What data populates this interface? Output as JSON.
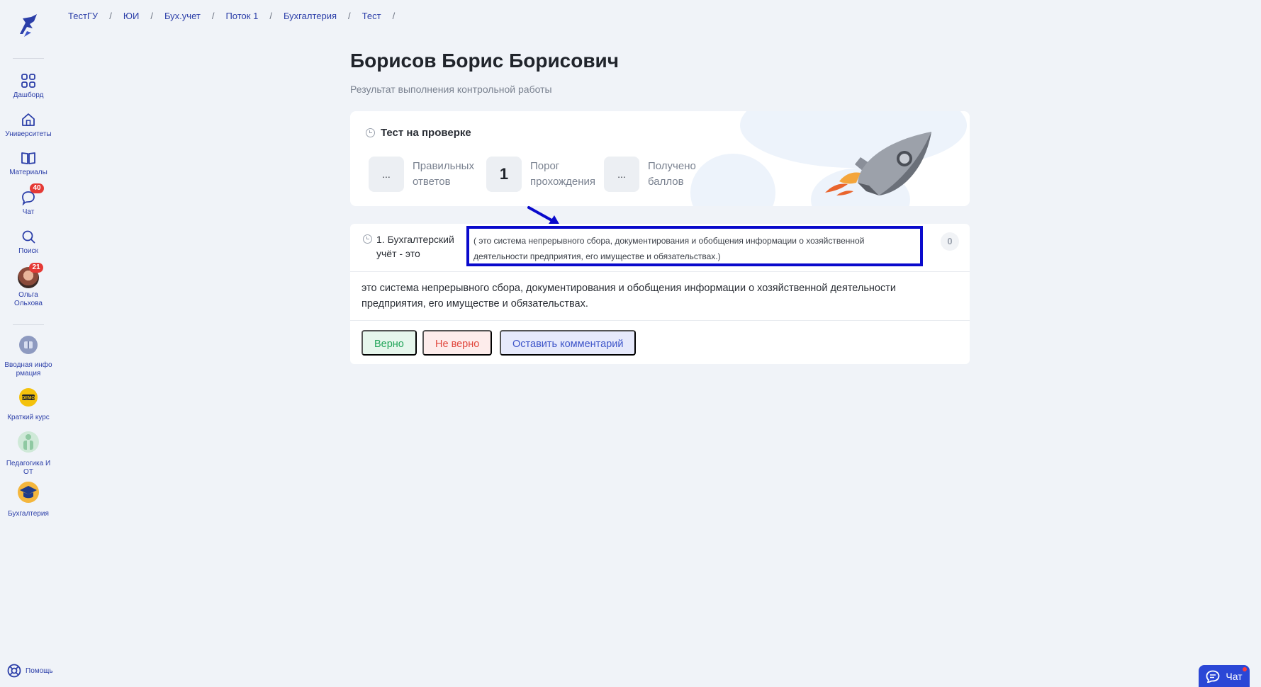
{
  "breadcrumb": [
    "ТестГУ",
    "ЮИ",
    "Бух.учет",
    "Поток 1",
    "Бухгалтерия",
    "Тест"
  ],
  "breadcrumb_sep": "/",
  "sidebar": {
    "items": [
      {
        "label": "Дашборд",
        "icon": "grid-icon"
      },
      {
        "label": "Университеты",
        "icon": "home-icon"
      },
      {
        "label": "Материалы",
        "icon": "book-icon"
      },
      {
        "label": "Чат",
        "icon": "chat-icon",
        "badge": "40"
      },
      {
        "label": "Поиск",
        "icon": "search-icon"
      },
      {
        "label": "Ольга Ольхова",
        "icon": "avatar",
        "badge": "21"
      }
    ],
    "courses": [
      {
        "label": "Вводная инфо рмация",
        "icon": "course-intro-icon"
      },
      {
        "label": "Краткий курс",
        "icon": "demo-icon"
      },
      {
        "label": "Педагогика И ОТ",
        "icon": "pedagogy-icon"
      },
      {
        "label": "Бухгалтерия",
        "icon": "graduation-cap-icon"
      }
    ],
    "help": "Помощь"
  },
  "header": {
    "title": "Борисов Борис Борисович",
    "subtitle": "Результат выполнения контрольной работы"
  },
  "summary": {
    "title": "Тест на проверке",
    "stats": [
      {
        "value": "...",
        "label": "Правильных ответов"
      },
      {
        "value": "1",
        "label": "Порог прохождения"
      },
      {
        "value": "...",
        "label": "Получено баллов"
      }
    ]
  },
  "question": {
    "number_text": "1. Бухгалтерский учёт - это",
    "highlight_text": "( это система непрерывного сбора, документирования и обобщения информации о хозяйственной деятельности предприятия, его имуществе и обязательствах.)",
    "score": "0",
    "answer": "это система непрерывного сбора, документирования и обобщения информации о хозяйственной деятельности предприятия, его имуществе и обязательствах.",
    "buttons": {
      "correct": "Верно",
      "incorrect": "Не верно",
      "comment": "Оставить комментарий"
    }
  },
  "chat_fab": "Чат",
  "colors": {
    "accent": "#2b3ea8",
    "highlight_border": "#0a0acc",
    "badge": "#e53935"
  }
}
